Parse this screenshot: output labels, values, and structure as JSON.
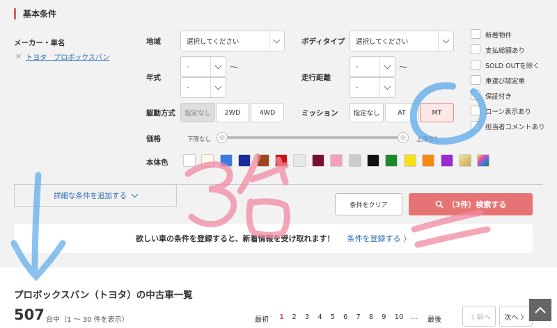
{
  "section_title": "基本条件",
  "maker": {
    "label": "メーカー・車名",
    "chip": "トヨタ　プロボックスバン"
  },
  "region": {
    "label": "地域",
    "value": "選択してください"
  },
  "body_type": {
    "label": "ボディタイプ",
    "value": "選択してください"
  },
  "year": {
    "label": "年式",
    "from": "-",
    "to": "-",
    "tilde": "〜"
  },
  "mileage": {
    "label": "走行距離",
    "from": "-",
    "to": "-",
    "tilde": "〜"
  },
  "drive": {
    "label": "駆動方式",
    "options": [
      "指定なし",
      "2WD",
      "4WD"
    ]
  },
  "mission": {
    "label": "ミッション",
    "options": [
      "指定なし",
      "AT",
      "MT"
    ],
    "selected": "MT"
  },
  "price": {
    "label": "価格",
    "min_label": "下限なし",
    "max_label": "上限なし"
  },
  "color": {
    "label": "本体色",
    "swatches": [
      "#ffffff",
      "#fdf8ea",
      "#3b7be0",
      "#1b2a9c",
      "#a0441f",
      "#d11010",
      "#e8e8e8",
      "#7a0f2c",
      "#f3a0b8",
      "#cccccc",
      "#111111",
      "#1b8a2a",
      "#f5e01a",
      "#f58a10",
      "#9a2ccf",
      "#e0c56a",
      "#e94bb0"
    ]
  },
  "checkboxes": [
    "新着物件",
    "支払総額あり",
    "SOLD OUTを除く",
    "車選び認定車",
    "保証付き",
    "ローン表示あり",
    "担当者コメントあり"
  ],
  "add_conditions": "詳細な条件を追加する",
  "clear_button": "条件をクリア",
  "search_button": "（3件）検索する",
  "banner": {
    "text": "欲しい車の条件を登録すると、新着情報を受け取れます！",
    "link": "条件を登録する"
  },
  "results": {
    "title": "プロボックスバン（トヨタ）の中古車一覧",
    "count": "507",
    "count_sub": "台中（1 〜 30 件を表示）"
  },
  "pagination": {
    "first": "最初",
    "pages": [
      "1",
      "2",
      "3",
      "4",
      "5",
      "6",
      "7",
      "8",
      "9",
      "10"
    ],
    "ellipsis": "...",
    "last": "最後",
    "prev": "〈 前へ",
    "next": "次へ 〉",
    "current": "1"
  },
  "colors": {
    "accent": "#e25b5b",
    "link": "#2a6bb4",
    "search": "#e77474",
    "annotation_pink": "#f08aa0",
    "annotation_blue": "#5aa8e8"
  },
  "annotations": {
    "handwritten": "3台"
  }
}
